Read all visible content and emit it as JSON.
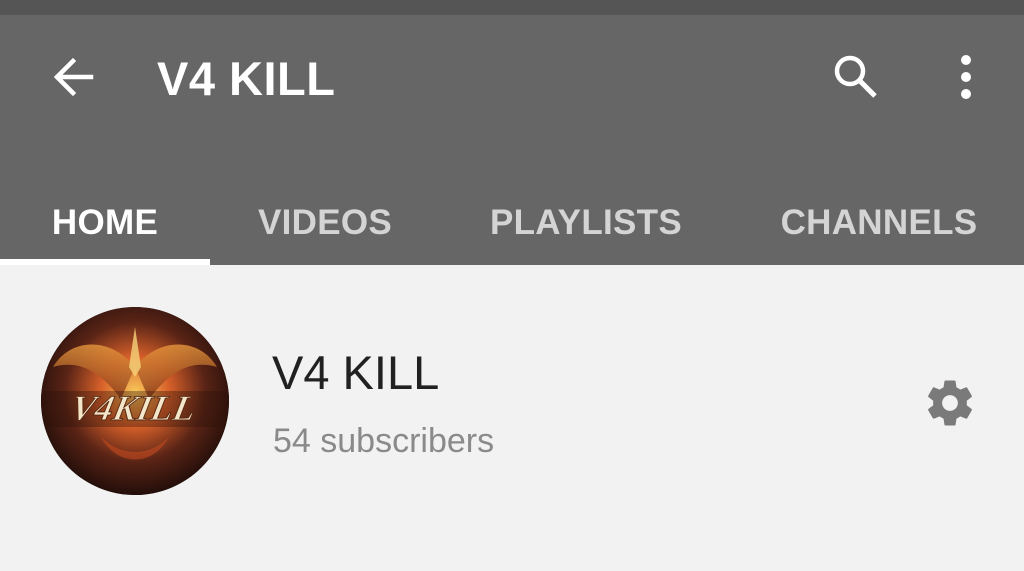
{
  "app_bar": {
    "back_icon": "arrow-back-icon",
    "title": "V4 KILL",
    "search_icon": "search-icon",
    "more_icon": "more-vert-icon"
  },
  "tabs": [
    {
      "label": "HOME",
      "active": true
    },
    {
      "label": "VIDEOS",
      "active": false
    },
    {
      "label": "PLAYLISTS",
      "active": false
    },
    {
      "label": "CHANNELS",
      "active": false
    }
  ],
  "channel": {
    "avatar_logo_text": "V4KILL",
    "name": "V4 KILL",
    "subscribers": "54 subscribers",
    "settings_icon": "gear-icon"
  },
  "colors": {
    "app_bar": "#666666",
    "status_strip": "#555555",
    "page_background": "#f2f2f2",
    "tab_indicator": "#ffffff",
    "settings_icon": "#7a7a7a"
  }
}
